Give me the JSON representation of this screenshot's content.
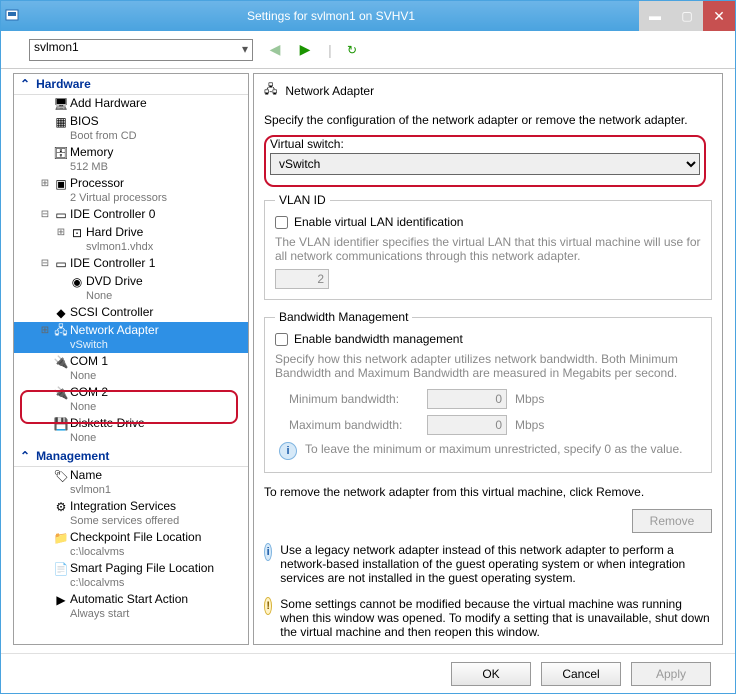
{
  "window": {
    "title": "Settings for svlmon1 on SVHV1"
  },
  "vm_selector": {
    "value": "svlmon1"
  },
  "tree": {
    "hardware_label": "Hardware",
    "management_label": "Management",
    "items": {
      "add_hw": "Add Hardware",
      "bios": "BIOS",
      "bios_sub": "Boot from CD",
      "memory": "Memory",
      "memory_sub": "512 MB",
      "processor": "Processor",
      "processor_sub": "2 Virtual processors",
      "ide0": "IDE Controller 0",
      "hard_drive": "Hard Drive",
      "hard_drive_sub": "svlmon1.vhdx",
      "ide1": "IDE Controller 1",
      "dvd": "DVD Drive",
      "dvd_sub": "None",
      "scsi": "SCSI Controller",
      "net": "Network Adapter",
      "net_sub": "vSwitch",
      "com1": "COM 1",
      "com1_sub": "None",
      "com2": "COM 2",
      "com2_sub": "None",
      "diskette": "Diskette Drive",
      "diskette_sub": "None",
      "name": "Name",
      "name_sub": "svlmon1",
      "integ": "Integration Services",
      "integ_sub": "Some services offered",
      "chk": "Checkpoint File Location",
      "chk_sub": "c:\\localvms",
      "smart": "Smart Paging File Location",
      "smart_sub": "c:\\localvms",
      "auto": "Automatic Start Action",
      "auto_sub": "Always start"
    }
  },
  "panel": {
    "title": "Network Adapter",
    "desc": "Specify the configuration of the network adapter or remove the network adapter.",
    "vs_label": "Virtual switch:",
    "vs_value": "vSwitch",
    "vlan": {
      "legend": "VLAN ID",
      "enable": "Enable virtual LAN identification",
      "help": "The VLAN identifier specifies the virtual LAN that this virtual machine will use for all network communications through this network adapter.",
      "value": "2"
    },
    "bw": {
      "legend": "Bandwidth Management",
      "enable": "Enable bandwidth management",
      "help": "Specify how this network adapter utilizes network bandwidth. Both Minimum Bandwidth and Maximum Bandwidth are measured in Megabits per second.",
      "min_label": "Minimum bandwidth:",
      "max_label": "Maximum bandwidth:",
      "min_val": "0",
      "max_val": "0",
      "unit": "Mbps",
      "tip": "To leave the minimum or maximum unrestricted, specify 0 as the value."
    },
    "remove_text": "To remove the network adapter from this virtual machine, click Remove.",
    "remove_btn": "Remove",
    "info1": "Use a legacy network adapter instead of this network adapter to perform a network-based installation of the guest operating system or when integration services are not installed in the guest operating system.",
    "info2": "Some settings cannot be modified because the virtual machine was running when this window was opened. To modify a setting that is unavailable, shut down the virtual machine and then reopen this window."
  },
  "footer": {
    "ok": "OK",
    "cancel": "Cancel",
    "apply": "Apply"
  }
}
